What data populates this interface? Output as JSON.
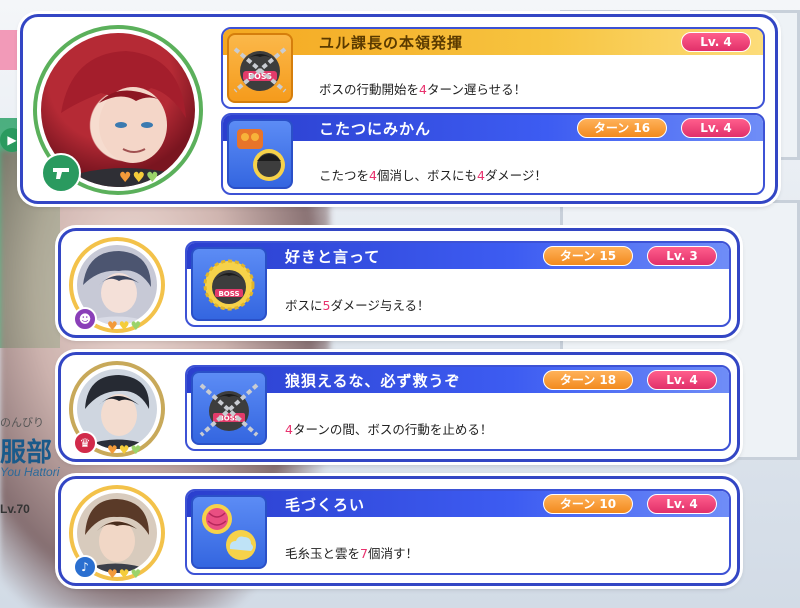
{
  "background": {
    "name": "服部",
    "subtitle": "のんびり",
    "english": "You Hattori",
    "level": "Lv.70"
  },
  "cards": [
    {
      "attribute_icon": "gun-icon",
      "hearts": [
        "orange",
        "yellow",
        "green"
      ],
      "skills": [
        {
          "title": "ユル課長の本領発揮",
          "turn": "",
          "level": "Lv. 4",
          "desc_parts": [
            "ボスの行動開始を",
            "4",
            "ターン遅らせる！"
          ],
          "icon": "boss-chain-icon",
          "style": "gold"
        },
        {
          "title": "こたつにみかん",
          "turn": "ターン  16",
          "level": "Lv. 4",
          "desc_parts": [
            "こたつを",
            "4",
            "個消し、ボスにも",
            "4",
            "ダメージ！"
          ],
          "icon": "kotatsu-icon",
          "style": "blue"
        }
      ]
    },
    {
      "attribute_icon": "drama-mask-icon",
      "hearts": [
        "orange",
        "yellow",
        "green"
      ],
      "skills": [
        {
          "title": "好きと言って",
          "turn": "ターン  15",
          "level": "Lv. 3",
          "desc_parts": [
            "ボスに",
            "5",
            "ダメージ与える！"
          ],
          "icon": "boss-face-icon",
          "style": "blue"
        }
      ]
    },
    {
      "attribute_icon": "crown-icon",
      "hearts": [
        "orange",
        "yellow",
        "green"
      ],
      "skills": [
        {
          "title": "狼狽えるな、必ず救うぞ",
          "turn": "ターン  18",
          "level": "Lv. 4",
          "desc_parts": [
            "4",
            "ターンの間、ボスの行動を止める！"
          ],
          "icon": "boss-chain-icon",
          "style": "blue"
        }
      ]
    },
    {
      "attribute_icon": "note-icon",
      "hearts": [
        "orange",
        "yellow",
        "green"
      ],
      "skills": [
        {
          "title": "毛づくろい",
          "turn": "ターン  10",
          "level": "Lv. 4",
          "desc_parts": [
            "毛糸玉と雲を",
            "7",
            "個消す！"
          ],
          "icon": "yarn-cloud-icon",
          "style": "blue"
        }
      ]
    }
  ],
  "colors": {
    "frame_blue": "#3346c4",
    "header_gold": "#f4a821",
    "highlight_pink": "#e8326e",
    "turn_orange": "#f28a1e",
    "level_pink": "#e1306a"
  }
}
